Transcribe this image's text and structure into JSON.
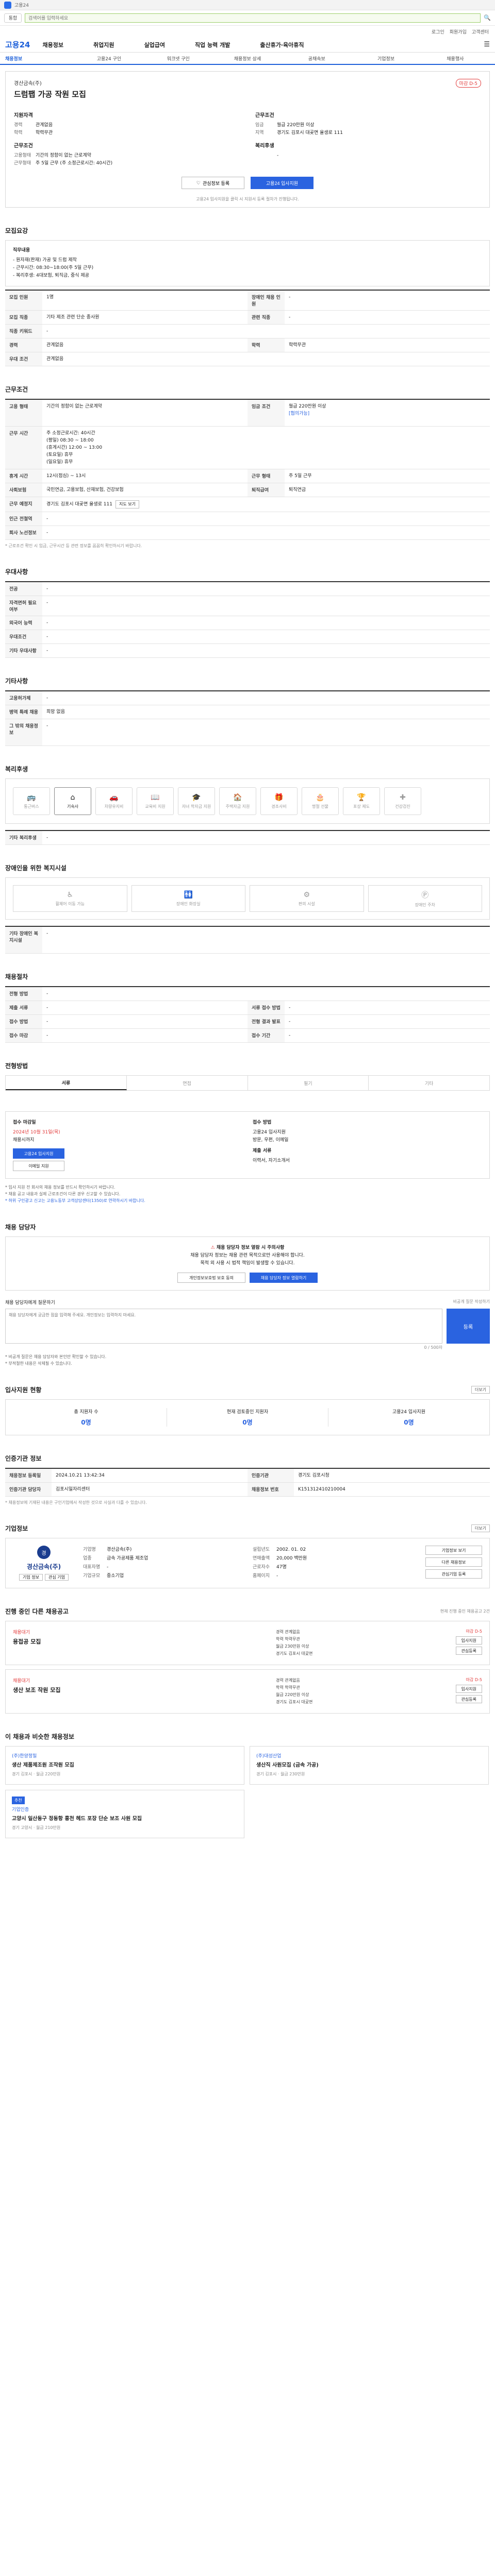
{
  "top": {
    "strip_label": "고용24",
    "search_scope": "통합",
    "search_placeholder": "검색어를 입력하세요"
  },
  "util": [
    "로그인",
    "회원가입",
    "고객센터"
  ],
  "gnb": {
    "brand": "고용24",
    "menu": [
      "채용정보",
      "취업지원",
      "실업급여",
      "직업 능력 개발",
      "출산휴가·육아휴직"
    ]
  },
  "subnav": [
    "채용정보",
    "고용24 구인",
    "워크넷 구인",
    "채용정보 상세",
    "공채속보",
    "기업정보",
    "채용행사"
  ],
  "job": {
    "company": "경산금속(주)",
    "title": "드럼팹 가공 작원 모집",
    "dday": "마감 D-5",
    "left_header": "지원자격",
    "left": [
      {
        "k": "경력",
        "v": "관계없음"
      },
      {
        "k": "학력",
        "v": "학력무관"
      }
    ],
    "left_header2": "근무조건",
    "left2": [
      {
        "k": "고용형태",
        "v": "기간의 정함이 없는 근로계약"
      },
      {
        "k": "근무형태",
        "v": "주 5일 근무 (주 소정근로시간: 40시간)"
      }
    ],
    "right_header": "근무조건",
    "right": [
      {
        "k": "임금",
        "v": "월급 220만원 이상"
      },
      {
        "k": "지역",
        "v": "경기도 김포시 대곶면 율생로 111"
      }
    ],
    "right_header2": "복리후생",
    "right2": [
      {
        "k": "",
        "v": "-"
      }
    ],
    "save_btn": "관심정보 등록",
    "apply_btn": "고용24 입사지원",
    "note": "고용24 입사지원을 클릭 시 지원서 등록 절차가 진행됩니다."
  },
  "recruit": {
    "title": "모집요강",
    "box_title": "직무내용",
    "box_lines": [
      "- 원자재(판재) 가공 및 드럼 제작",
      "- 근무시간: 08:30~18:00(주 5일 근무)",
      "- 복리후생: 4대보험, 퇴직금, 중식 제공"
    ],
    "rows": [
      {
        "k": "모집 인원",
        "v": "1명",
        "k2": "장애인 채용 인원",
        "v2": "-"
      },
      {
        "k": "모집 직종",
        "v": "기타 제조 관련 단순 종사원",
        "k2": "관련 직종",
        "v2": "-"
      },
      {
        "k": "직종 키워드",
        "v": "-",
        "k2": "",
        "v2": ""
      },
      {
        "k": "경력",
        "v": "관계없음",
        "k2": "학력",
        "v2": "학력무관"
      },
      {
        "k": "우대 조건",
        "v": "관계없음",
        "k2": "",
        "v2": ""
      }
    ]
  },
  "work": {
    "title": "근무조건",
    "r1": {
      "k": "고용 형태",
      "v": "기간의 정함이 없는 근로계약",
      "k2": "임금 조건",
      "v2": "월급 220만원 이상",
      "v2b": "[협의가능]"
    },
    "r2": {
      "k": "근무 시간",
      "v": "주 소정근로시간: 40시간",
      "v_lines": [
        "(평일) 08:30 ~ 18:00",
        "(휴게시간) 12:00 ~ 13:00",
        "(토요일) 휴무",
        "(일요일) 휴무"
      ]
    },
    "r3": {
      "k": "휴게 시간",
      "v": "12시(점심) ~ 13시",
      "k2": "근무 형태",
      "v2": "주 5일 근무"
    },
    "r4": {
      "k": "사회보험",
      "v": "국민연금, 고용보험, 산재보험, 건강보험",
      "k2": "퇴직급여",
      "v2": "퇴직연금"
    },
    "r5": {
      "k": "근무 예정지",
      "v": "경기도 김포시 대곶면 율생로 111",
      "btn": "지도 보기"
    },
    "r6": {
      "k": "인근 전철역",
      "v": "-"
    },
    "r7": {
      "k": "회사 노선정보",
      "v": "-"
    },
    "note": "* 근로조건 확인 시 임금, 근무시간 등 관련 정보를 꼼꼼히 확인하시기 바랍니다."
  },
  "prefer": {
    "title": "우대사항",
    "rows": [
      {
        "k": "전공",
        "v": "-"
      },
      {
        "k": "자격면허 필요 여부",
        "v": "-"
      },
      {
        "k": "외국어 능력",
        "v": "-"
      },
      {
        "k": "우대조건",
        "v": "-"
      },
      {
        "k": "기타 우대사항",
        "v": "-"
      }
    ]
  },
  "etc": {
    "title": "기타사항",
    "rows": [
      {
        "k": "고용허가제",
        "v": "-"
      },
      {
        "k": "병역 특례 채용",
        "v": "희망 없음"
      },
      {
        "k": "그 밖의 채용정보",
        "v": "-"
      }
    ]
  },
  "welfare": {
    "title": "복리후생",
    "items": [
      {
        "name": "통근버스",
        "icon": "bus-icon",
        "on": false
      },
      {
        "name": "기숙사",
        "icon": "house-icon",
        "on": true
      },
      {
        "name": "차량유지비",
        "icon": "car-icon",
        "on": false
      },
      {
        "name": "교육비 지원",
        "icon": "book-icon",
        "on": false
      },
      {
        "name": "자녀 학자금 지원",
        "icon": "cap-icon",
        "on": false
      },
      {
        "name": "주택자금 지원",
        "icon": "home-icon",
        "on": false
      },
      {
        "name": "경조사비",
        "icon": "gift-icon",
        "on": false
      },
      {
        "name": "명절 선물",
        "icon": "present-icon",
        "on": false
      },
      {
        "name": "포상 제도",
        "icon": "medal-icon",
        "on": false
      },
      {
        "name": "건강검진",
        "icon": "health-icon",
        "on": false
      }
    ],
    "other_label": "기타 복리후생",
    "other_value": "-"
  },
  "disability": {
    "title": "장애인을 위한 복지시설",
    "items": [
      "휠체어 이동 가능",
      "장애인 화장실",
      "편의 시설",
      "장애인 주차"
    ],
    "other_label": "기타 장애인 복지시설",
    "other_value": "-"
  },
  "apply_process": {
    "title": "채용절차",
    "rows": [
      {
        "k": "전형 방법",
        "v": "-"
      },
      {
        "k": "제출 서류",
        "v": "-",
        "k2": "서류 접수 방법",
        "v2": "-"
      },
      {
        "k": "접수 방법",
        "v": "-",
        "k2": "전형 결과 발표",
        "v2": "-"
      },
      {
        "k": "접수 마감",
        "v": "-",
        "k2": "접수 기간",
        "v2": "-"
      }
    ]
  },
  "method": {
    "title": "전형방법",
    "tabs": [
      "서류",
      "면접",
      "필기",
      "기타"
    ],
    "h1": "접수 마감일",
    "l1": [
      "2024년 10월 31일(목)",
      "채용시까지"
    ],
    "h2": "접수 방법",
    "l2": [
      "고용24 입사지원",
      "방문, 우편, 이메일"
    ],
    "h3": "제출 서류",
    "l3": [
      "이력서, 자기소개서"
    ],
    "btn1": "고용24 입사지원",
    "btn2": "이메일 지원",
    "notes": [
      "* 입사 지원 전 회사의 채용 정보를 반드시 확인하시기 바랍니다.",
      "* 채용 공고 내용과 실제 근로조건이 다른 경우 신고할 수 있습니다.",
      "* 허위 구인광고 신고는 고용노동부 고객상담센터(1350)로 연락하시기 바랍니다."
    ]
  },
  "contact": {
    "title": "채용 담당자",
    "warn": "채용 담당자 정보 열람 시 주의사항",
    "line1": "채용 담당자 정보는 채용 관련 목적으로만 사용해야 합니다.",
    "line2": "목적 외 사용 시 법적 책임이 발생할 수 있습니다.",
    "btn1": "개인정보보호법 보호 동의",
    "btn2": "채용 담당자 정보 열람하기"
  },
  "qa": {
    "title": "채용 담당자에게 질문하기",
    "right": "비공개 질문 작성하기",
    "placeholder": "채용 담당자에게 궁금한 점을 입력해 주세요. 개인정보는 입력하지 마세요.",
    "btn": "등록",
    "count": "0 / 500자",
    "notes": [
      "* 비공개 질문은 채용 담당자와 본인만 확인할 수 있습니다.",
      "* 부적절한 내용은 삭제될 수 있습니다."
    ]
  },
  "status": {
    "title": "입사지원 현황",
    "more": "더보기",
    "cells": [
      {
        "label": "총 지원자 수",
        "n": "0명"
      },
      {
        "label": "현재 검토중인 지원자",
        "n": "0명"
      },
      {
        "label": "고용24 입사지원",
        "n": "0명"
      }
    ]
  },
  "info": {
    "title": "인증기관 정보",
    "rows": [
      {
        "k": "채용정보 등록일",
        "v": "2024.10.21 13:42:34",
        "k2": "인증기관",
        "v2": "경기도 김포시청"
      },
      {
        "k": "인증기관 담당자",
        "v": "김포시일자리센터",
        "k2": "채용정보 번호",
        "v2": "K151312410210004"
      }
    ],
    "note": "* 채용정보에 기재된 내용은 구인기업에서 작성한 것으로 사실과 다를 수 있습니다."
  },
  "company_info": {
    "title": "기업정보",
    "name": "경산금속(주)",
    "mark": "경",
    "b1": "기업 정보",
    "b2": "관심 기업",
    "c1": [
      {
        "k": "기업명",
        "v": "경산금속(주)"
      },
      {
        "k": "업종",
        "v": "금속 가공제품 제조업"
      },
      {
        "k": "대표자명",
        "v": "-"
      },
      {
        "k": "기업규모",
        "v": "중소기업"
      }
    ],
    "c2": [
      {
        "k": "설립년도",
        "v": "2002. 01. 02"
      },
      {
        "k": "연매출액",
        "v": "20,000 백만원"
      },
      {
        "k": "근로자수",
        "v": "47명"
      },
      {
        "k": "홈페이지",
        "v": "-"
      }
    ],
    "btns": [
      "기업정보 보기",
      "다른 채용정보",
      "관심기업 등록"
    ]
  },
  "other_jobs": {
    "title": "진행 중인 다른 채용공고",
    "more_note": "현재 진행 중인 채용공고 2건",
    "items": [
      {
        "company": "채용대기",
        "title": "용접공 모집",
        "lines": [
          "경력 관계없음",
          "학력 학력무관",
          "월급 230만원 이상",
          "경기도 김포시 대곶면"
        ],
        "right": [
          "마감 D-5",
          "입사지원",
          "관심등록"
        ]
      },
      {
        "company": "채용대기",
        "title": "생산 보조 작원 모집",
        "lines": [
          "경력 관계없음",
          "학력 학력무관",
          "월급 220만원 이상",
          "경기도 김포시 대곶면"
        ],
        "right": [
          "마감 D-5",
          "입사지원",
          "관심등록"
        ]
      }
    ]
  },
  "ai": {
    "title": "이 채용과 비슷한 채용정보",
    "items": [
      {
        "co": "(주)한양정밀",
        "title": "생산 제품제조원 조작원 모집",
        "meta": "경기 김포시 · 월급 220만원",
        "tag": ""
      },
      {
        "co": "(주)대성산업",
        "title": "생산직 사원모집 (금속 가공)",
        "meta": "경기 김포시 · 월급 230만원",
        "tag": ""
      },
      {
        "co": "기업인증",
        "title": "고양시 일산동구 정동항 홍천 헤드 포장 단순 보조 사원 모집",
        "meta": "경기 고양시 · 월급 210만원",
        "tag": "추천"
      }
    ]
  }
}
